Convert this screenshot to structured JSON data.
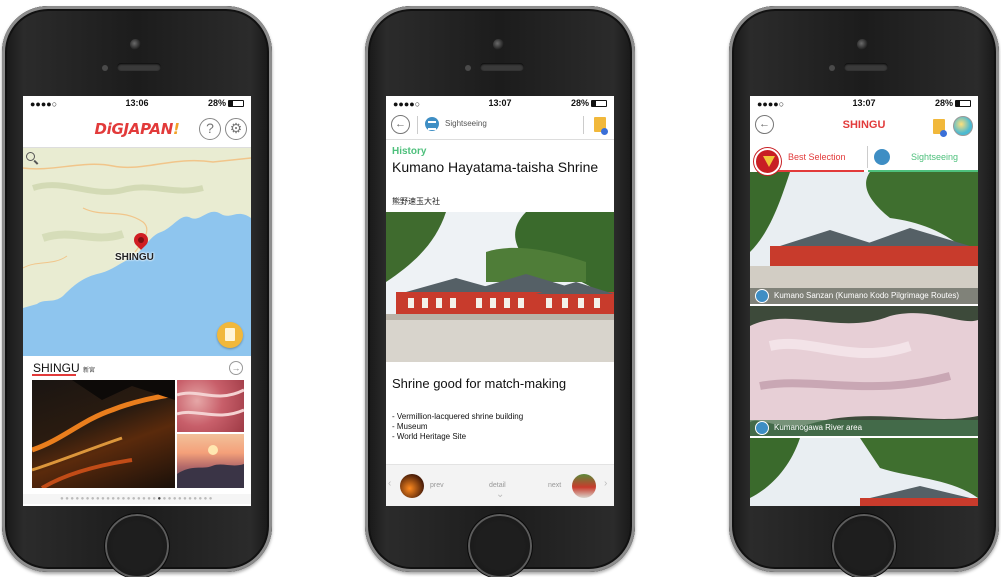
{
  "status_bar": {
    "signal": "●●●●○",
    "battery": "28%",
    "phone1_time": "13:06",
    "phone2_time": "13:07",
    "phone3_time": "13:07"
  },
  "phone1": {
    "logo_main": "DiGJAPAN",
    "logo_mark": "!",
    "help_glyph": "?",
    "settings_glyph": "⚙",
    "map_city_label": "SHINGU",
    "city_name": "SHINGU",
    "city_name_jp": "新宮",
    "arrow_glyph": "→",
    "pager_left": "●●●●●●●●●●●●●●●●●●●",
    "pager_active": "●",
    "pager_right": "●●●●●●●●●●"
  },
  "phone2": {
    "back_glyph": "←",
    "category": "Sightseeing",
    "tag": "History",
    "title": "Kumano Hayatama-taisha Shrine",
    "title_jp": "熊野速玉大社",
    "tagline": "Shrine good for match-making",
    "bullets": [
      "- Vermillion-lacquered shrine building",
      "- Museum",
      "- World Heritage Site"
    ],
    "footer": {
      "prev": "prev",
      "detail": "detail",
      "next": "next",
      "left_chevron": "‹",
      "right_chevron": "›",
      "down_chevron": "⌄"
    }
  },
  "phone3": {
    "back_glyph": "←",
    "title": "SHINGU",
    "tab_best": "Best Selection",
    "tab_sightseeing": "Sightseeing",
    "cards": [
      "Kumano Sanzan (Kumano Kodo Pilgrimage Routes)",
      "Kumanogawa River area"
    ]
  },
  "colors": {
    "brand_red": "#e23a3a",
    "accent_green": "#4ec07c",
    "map_sea": "#8ec5ee",
    "map_land": "#e9ecd2",
    "book_yellow": "#f1b83b"
  }
}
